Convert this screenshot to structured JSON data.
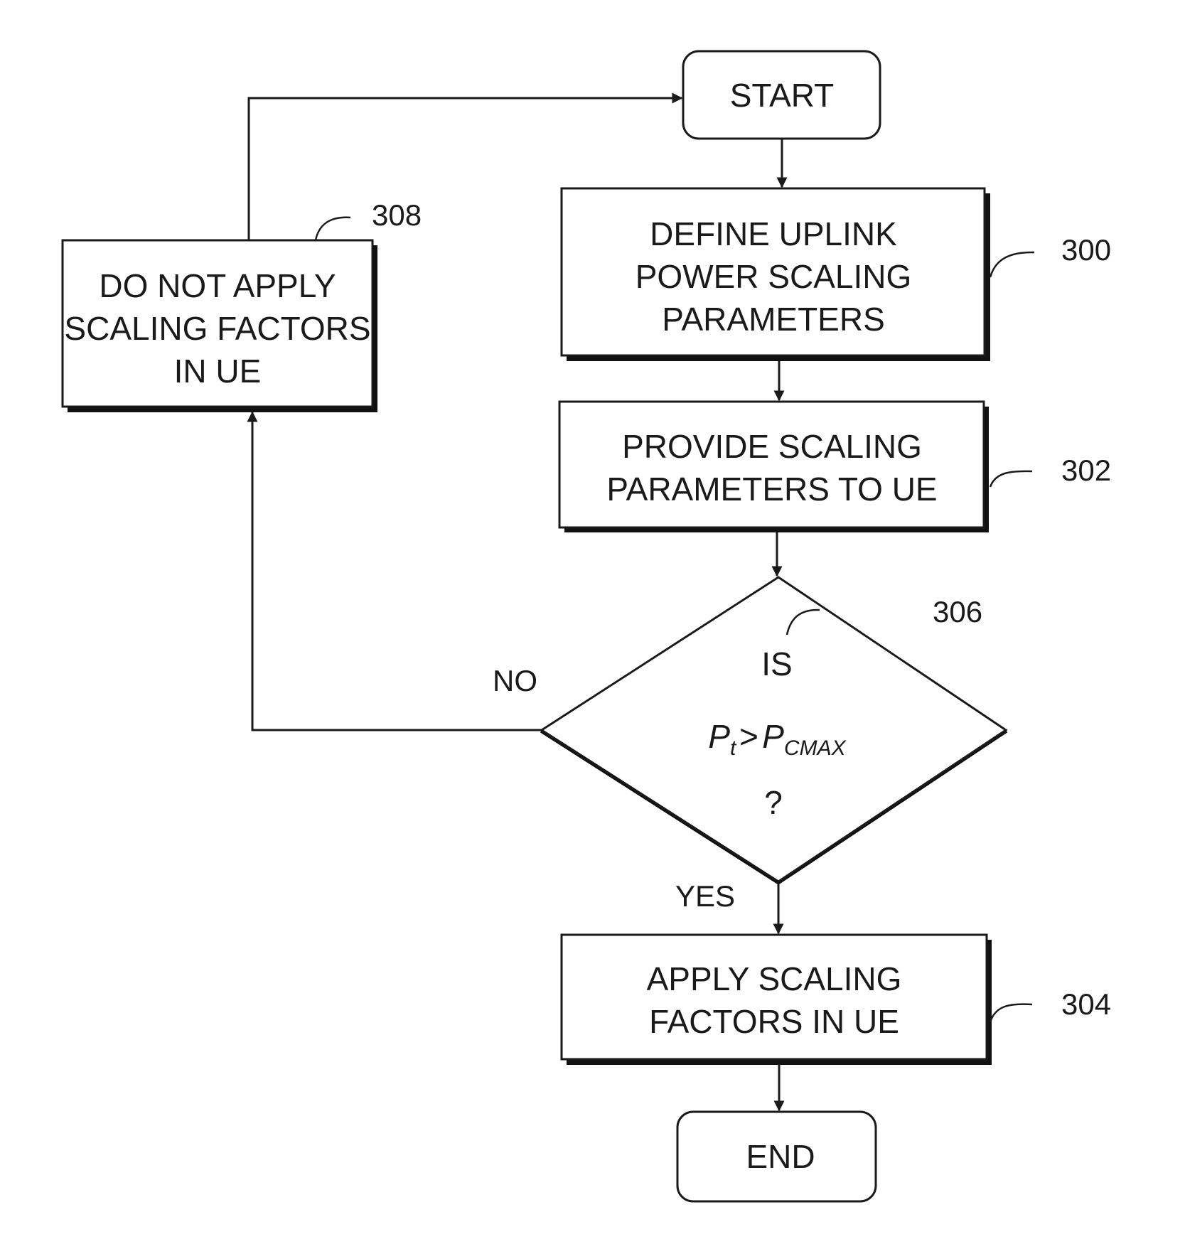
{
  "diagram": {
    "type": "flowchart",
    "nodes": {
      "start": {
        "label": "START"
      },
      "step_300": {
        "ref": "300",
        "lines": [
          "DEFINE UPLINK",
          "POWER SCALING",
          "PARAMETERS"
        ]
      },
      "step_302": {
        "ref": "302",
        "lines": [
          "PROVIDE SCALING",
          "PARAMETERS TO UE"
        ]
      },
      "decision_306": {
        "ref": "306",
        "line1": "IS",
        "lhs": "P",
        "lhs_sub": "t",
        "op": ">",
        "rhs": "P",
        "rhs_sub": "CMAX",
        "line3": "?"
      },
      "step_304": {
        "ref": "304",
        "lines": [
          "APPLY SCALING",
          "FACTORS IN UE"
        ]
      },
      "step_308": {
        "ref": "308",
        "lines": [
          "DO NOT APPLY",
          "SCALING FACTORS",
          "IN UE"
        ]
      },
      "end": {
        "label": "END"
      }
    },
    "edges": {
      "yes_label": "YES",
      "no_label": "NO"
    }
  }
}
